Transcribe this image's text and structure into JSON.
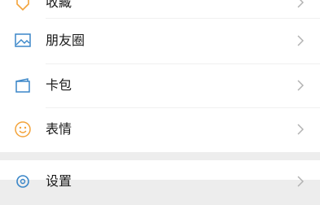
{
  "menu": {
    "items": [
      {
        "label": "收藏",
        "icon": "favorites-icon"
      },
      {
        "label": "朋友圈",
        "icon": "moments-icon"
      },
      {
        "label": "卡包",
        "icon": "cards-icon"
      },
      {
        "label": "表情",
        "icon": "stickers-icon"
      },
      {
        "label": "设置",
        "icon": "settings-icon"
      }
    ]
  },
  "colors": {
    "page_bg": "#ededed",
    "row_bg": "#ffffff",
    "icon_blue": "#3a86c8",
    "icon_orange": "#f3a33a",
    "chevron": "#b2b2b2"
  }
}
